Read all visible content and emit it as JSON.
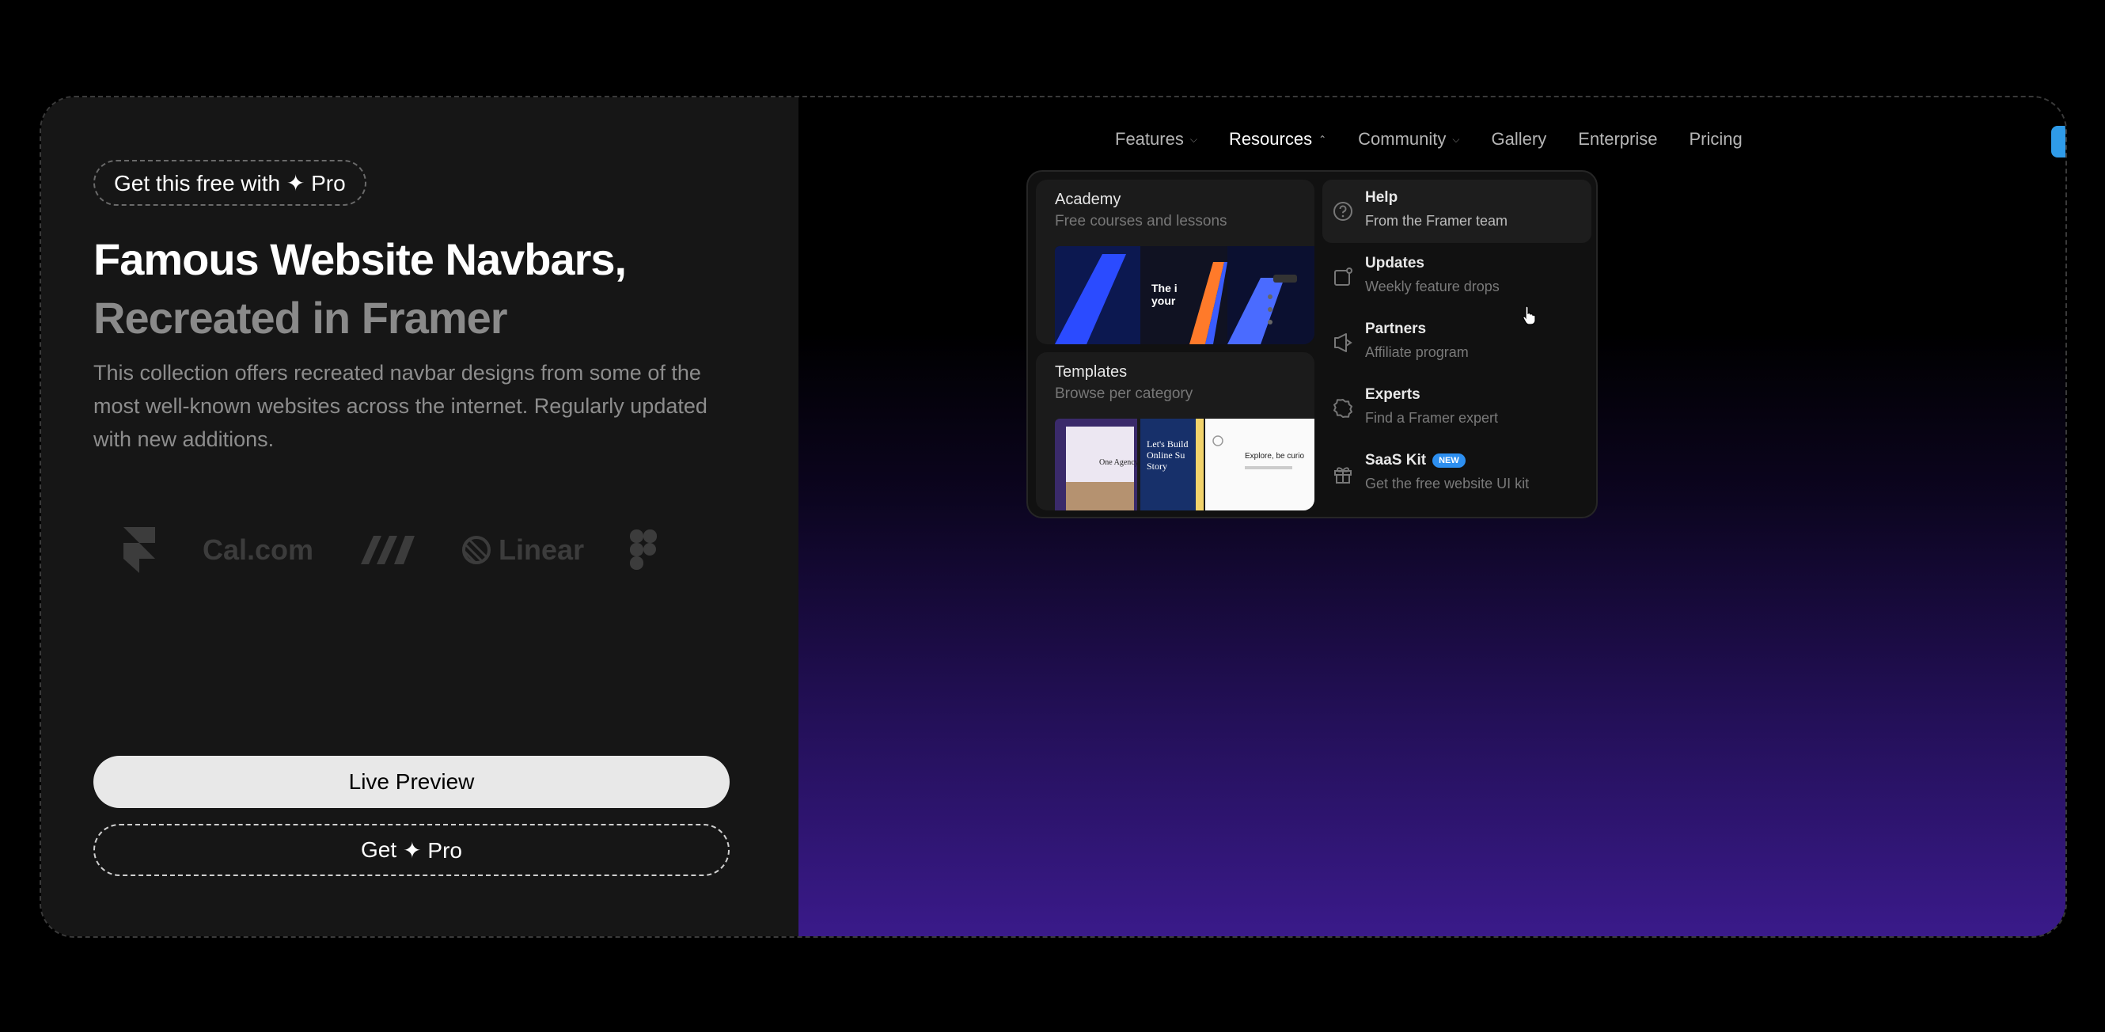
{
  "left": {
    "pro_pill": "Get this free with ✦ Pro",
    "headline_line1": "Famous Website Navbars,",
    "headline_line2": "Recreated in Framer",
    "description": "This collection offers recreated navbar designs from some of the most well-known websites across the internet. Regularly updated with new additions.",
    "logos": [
      "framer-logo",
      "Cal.com",
      "make-logo",
      "Linear",
      "figma-logo"
    ],
    "logo_text_cal": "Cal.com",
    "logo_text_linear": "Linear",
    "live_preview": "Live Preview",
    "get_pro_prefix": "Get",
    "get_pro_suffix": "✦ Pro"
  },
  "nav": {
    "items": [
      {
        "label": "Features",
        "dropdown": true
      },
      {
        "label": "Resources",
        "dropdown": true,
        "active": true
      },
      {
        "label": "Community",
        "dropdown": true
      },
      {
        "label": "Gallery"
      },
      {
        "label": "Enterprise"
      },
      {
        "label": "Pricing"
      }
    ]
  },
  "dropdown": {
    "academy": {
      "title": "Academy",
      "subtitle": "Free courses and lessons"
    },
    "templates": {
      "title": "Templates",
      "subtitle": "Browse per category"
    },
    "items": [
      {
        "label": "Help",
        "sub": "From the Framer team",
        "icon": "help-circle-icon"
      },
      {
        "label": "Updates",
        "sub": "Weekly feature drops",
        "icon": "updates-icon"
      },
      {
        "label": "Partners",
        "sub": "Affiliate program",
        "icon": "megaphone-icon"
      },
      {
        "label": "Experts",
        "sub": "Find a Framer expert",
        "icon": "badge-icon"
      },
      {
        "label": "SaaS Kit",
        "sub": "Get the free website UI kit",
        "icon": "gift-icon",
        "badge": "NEW"
      }
    ]
  },
  "colors": {
    "accent": "#2d8ff0",
    "gradient_end": "#3a1a8a"
  }
}
